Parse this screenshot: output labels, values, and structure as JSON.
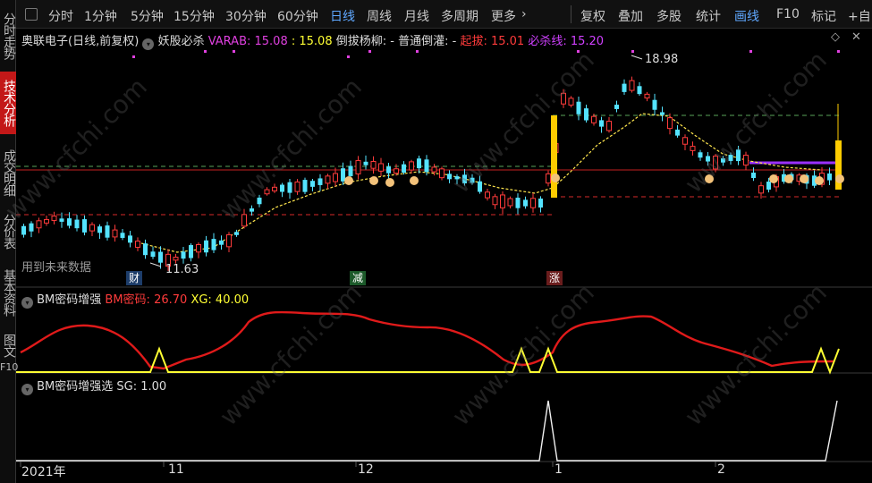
{
  "sidebar": {
    "tabs": [
      "分时走势",
      "技术分析",
      "成交明细",
      "分价表",
      "基本资料",
      "图文"
    ],
    "f10": "F10"
  },
  "toolbar": {
    "periods": [
      "分时",
      "1分钟",
      "5分钟",
      "15分钟",
      "30分钟",
      "60分钟",
      "日线",
      "周线",
      "月线",
      "多周期",
      "更多"
    ],
    "active_period": "日线",
    "more_arrow": "›",
    "right_buttons": [
      "复权",
      "叠加",
      "多股",
      "统计",
      "画线",
      "F10",
      "标记",
      "+自"
    ],
    "active_right": "画线"
  },
  "main_info": {
    "title": "奥联电子(日线,前复权)",
    "indicator": "妖股必杀",
    "varab_label": "VARAB: 15.08",
    "colon_value": ": 15.08",
    "daoba": "倒拔杨柳: -",
    "putong": "普通倒灌: -",
    "qiba": "起拔: 15.01",
    "bisha": "必杀线: 15.20"
  },
  "price_annotations": {
    "high": "18.98",
    "low": "11.63",
    "future_data": "用到未来数据"
  },
  "badges": {
    "cai": "财",
    "jian": "减",
    "zhang": "涨"
  },
  "sub1": {
    "title": "BM密码增强",
    "bm": "BM密码: 26.70",
    "xg": "XG: 40.00"
  },
  "sub2": {
    "title": "BM密码增强选",
    "sg": "SG: 1.00"
  },
  "x_axis": {
    "labels": [
      "2021年",
      "11",
      "12",
      "1",
      "2"
    ]
  },
  "watermark": "www.cfchi.com",
  "colors": {
    "up": "#ff3b3b",
    "down": "#54e3ff",
    "bm_line": "#e01a1a",
    "xg_line": "#ffff33",
    "accent": "#5fa8ff",
    "active_tab": "#c31818"
  }
}
